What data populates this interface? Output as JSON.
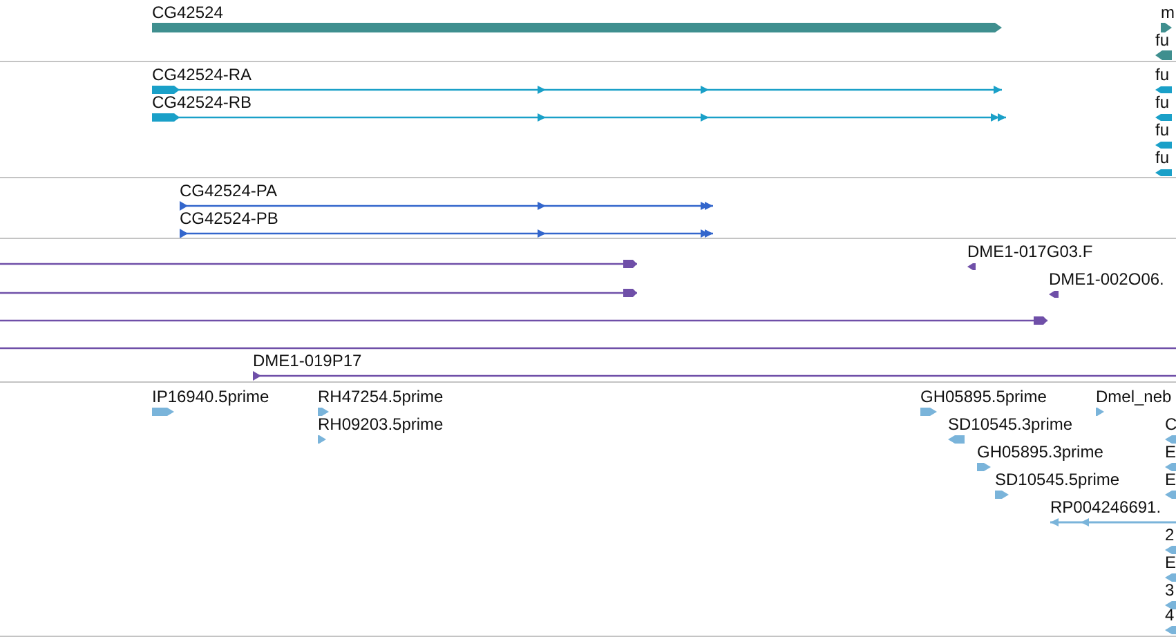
{
  "tracks": [
    {
      "kind": "gene",
      "features": [
        {
          "label": "CG42524",
          "reverse": false
        },
        {
          "label": "m",
          "reverse": false
        },
        {
          "label": "fu",
          "reverse": true
        }
      ]
    },
    {
      "kind": "mrna",
      "features": [
        {
          "label": "CG42524-RA",
          "reverse": false
        },
        {
          "label": "CG42524-RB",
          "reverse": false
        },
        {
          "label": "fu",
          "reverse": true
        },
        {
          "label": "fu",
          "reverse": true
        },
        {
          "label": "fu",
          "reverse": true
        },
        {
          "label": "fu",
          "reverse": true
        }
      ]
    },
    {
      "kind": "protein",
      "features": [
        {
          "label": "CG42524-PA",
          "reverse": false
        },
        {
          "label": "CG42524-PB",
          "reverse": false
        }
      ]
    },
    {
      "kind": "clone",
      "features": [
        {
          "label": "DME1-017G03.F",
          "reverse": true
        },
        {
          "label": "DME1-002O06.",
          "reverse": true
        },
        {
          "reverse": false
        },
        {
          "reverse": false
        },
        {
          "reverse": false
        },
        {
          "truncated": true
        },
        {
          "label": "DME1-019P17",
          "reverse": false,
          "truncated": true
        }
      ]
    },
    {
      "kind": "est",
      "features": [
        {
          "label": "IP16940.5prime",
          "reverse": false
        },
        {
          "label": "RH47254.5prime",
          "reverse": false
        },
        {
          "label": "RH09203.5prime",
          "reverse": false
        },
        {
          "label": "GH05895.5prime",
          "reverse": false
        },
        {
          "label": "Dmel_neb",
          "reverse": false
        },
        {
          "label": "SD10545.3prime",
          "reverse": true
        },
        {
          "label": "GH05895.3prime",
          "reverse": false
        },
        {
          "label": "SD10545.5prime",
          "reverse": false
        },
        {
          "label": "RP004246691.",
          "reverse": true
        },
        {
          "label": "C",
          "reverse": true
        },
        {
          "label": "E",
          "reverse": true
        },
        {
          "label": "E",
          "reverse": true
        },
        {
          "label": "2",
          "reverse": true
        },
        {
          "label": "E",
          "reverse": true
        },
        {
          "label": "3",
          "reverse": true
        },
        {
          "label": "4",
          "reverse": true
        }
      ]
    }
  ]
}
